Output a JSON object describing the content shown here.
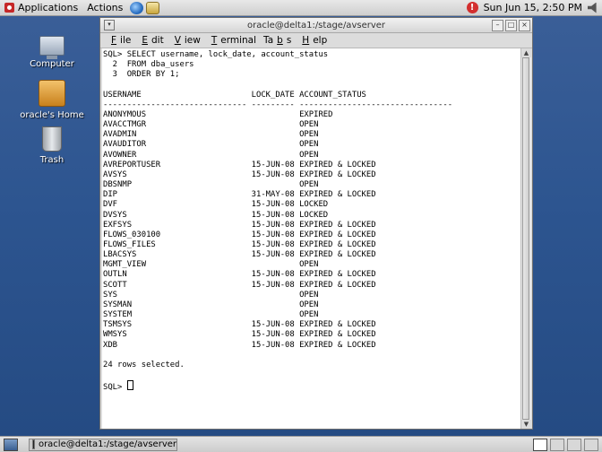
{
  "top_panel": {
    "applications": "Applications",
    "actions": "Actions",
    "clock": "Sun Jun 15,  2:50 PM"
  },
  "desktop_icons": [
    {
      "label": "Computer",
      "icon": "computer-icon"
    },
    {
      "label": "oracle's Home",
      "icon": "home-folder-icon"
    },
    {
      "label": "Trash",
      "icon": "trash-icon"
    }
  ],
  "window": {
    "title": "oracle@delta1:/stage/avserver",
    "menu": [
      "File",
      "Edit",
      "View",
      "Terminal",
      "Tabs",
      "Help"
    ]
  },
  "terminal": {
    "query": [
      "SQL> SELECT username, lock_date, account_status",
      "  2  FROM dba_users",
      "  3  ORDER BY 1;"
    ],
    "header": "USERNAME                       LOCK_DATE ACCOUNT_STATUS",
    "separator": "------------------------------ --------- --------------------------------",
    "rows": [
      [
        "ANONYMOUS",
        "",
        "EXPIRED"
      ],
      [
        "AVACCTMGR",
        "",
        "OPEN"
      ],
      [
        "AVADMIN",
        "",
        "OPEN"
      ],
      [
        "AVAUDITOR",
        "",
        "OPEN"
      ],
      [
        "AVOWNER",
        "",
        "OPEN"
      ],
      [
        "AVREPORTUSER",
        "15-JUN-08",
        "EXPIRED & LOCKED"
      ],
      [
        "AVSYS",
        "15-JUN-08",
        "EXPIRED & LOCKED"
      ],
      [
        "DBSNMP",
        "",
        "OPEN"
      ],
      [
        "DIP",
        "31-MAY-08",
        "EXPIRED & LOCKED"
      ],
      [
        "DVF",
        "15-JUN-08",
        "LOCKED"
      ],
      [
        "DVSYS",
        "15-JUN-08",
        "LOCKED"
      ],
      [
        "EXFSYS",
        "15-JUN-08",
        "EXPIRED & LOCKED"
      ],
      [
        "FLOWS_030100",
        "15-JUN-08",
        "EXPIRED & LOCKED"
      ],
      [
        "FLOWS_FILES",
        "15-JUN-08",
        "EXPIRED & LOCKED"
      ],
      [
        "LBACSYS",
        "15-JUN-08",
        "EXPIRED & LOCKED"
      ],
      [
        "MGMT_VIEW",
        "",
        "OPEN"
      ],
      [
        "OUTLN",
        "15-JUN-08",
        "EXPIRED & LOCKED"
      ],
      [
        "SCOTT",
        "15-JUN-08",
        "EXPIRED & LOCKED"
      ],
      [
        "SYS",
        "",
        "OPEN"
      ],
      [
        "SYSMAN",
        "",
        "OPEN"
      ],
      [
        "SYSTEM",
        "",
        "OPEN"
      ],
      [
        "TSMSYS",
        "15-JUN-08",
        "EXPIRED & LOCKED"
      ],
      [
        "WMSYS",
        "15-JUN-08",
        "EXPIRED & LOCKED"
      ],
      [
        "XDB",
        "15-JUN-08",
        "EXPIRED & LOCKED"
      ]
    ],
    "footer": "24 rows selected.",
    "prompt": "SQL> "
  },
  "taskbar": {
    "task_label": "oracle@delta1:/stage/avserver"
  }
}
